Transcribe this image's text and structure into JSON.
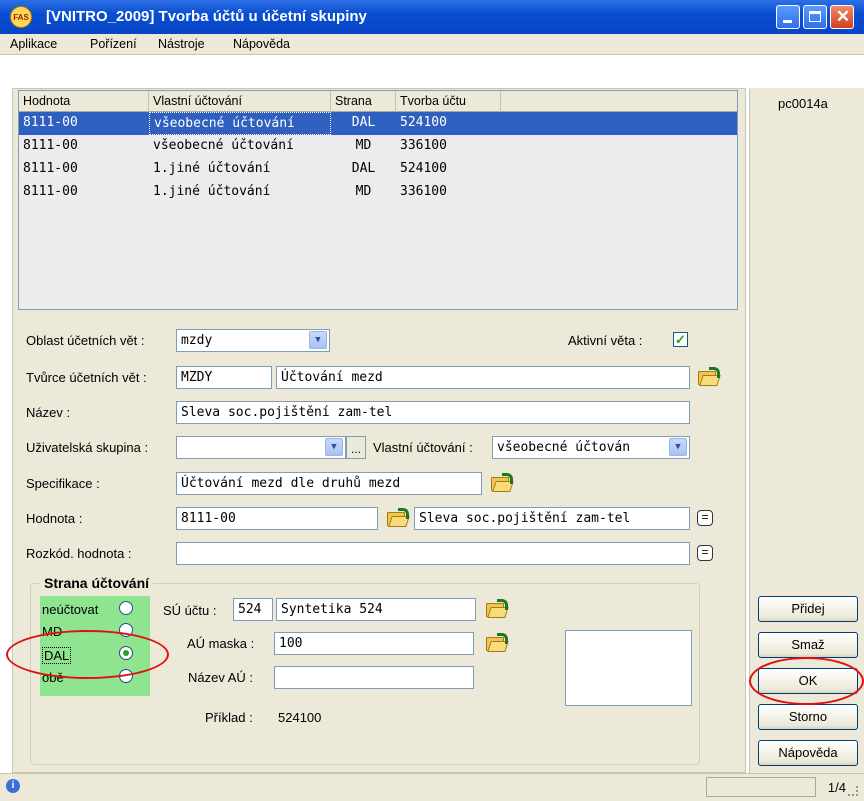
{
  "window": {
    "title": "[VNITRO_2009] Tvorba účtů u účetní skupiny",
    "logo_text": "FAS",
    "form_code": "pc0014a"
  },
  "menu": [
    "Aplikace",
    "Pořízení",
    "Nástroje",
    "Nápověda"
  ],
  "table": {
    "columns": [
      "Hodnota",
      "Vlastní účtování",
      "Strana",
      "Tvorba účtu"
    ],
    "rows": [
      [
        "8111-00",
        "všeobecné účtování",
        "DAL",
        "524100"
      ],
      [
        "8111-00",
        "všeobecné účtování",
        "MD",
        "336100"
      ],
      [
        "8111-00",
        "1.jiné účtování",
        "DAL",
        "524100"
      ],
      [
        "8111-00",
        "1.jiné účtování",
        "MD",
        "336100"
      ]
    ],
    "selected_row": 0
  },
  "form": {
    "oblast": {
      "label": "Oblast účetních vět :",
      "value": "mzdy"
    },
    "aktivni": {
      "label": "Aktivní věta :",
      "checked": true
    },
    "tvurce": {
      "label": "Tvůrce účetních vět :",
      "code": "MZDY",
      "name": "Účtování mezd"
    },
    "nazev": {
      "label": "Název :",
      "value": "Sleva soc.pojištění zam-tel"
    },
    "uzivatelska": {
      "label": "Uživatelská skupina :",
      "value": ""
    },
    "vlastni": {
      "label": "Vlastní účtování :",
      "value": "všeobecné účtován"
    },
    "specifikace": {
      "label": "Specifikace :",
      "value": "Účtování mezd dle druhů mezd"
    },
    "hodnota": {
      "label": "Hodnota :",
      "value": "8111-00",
      "name": "Sleva soc.pojištění zam-tel"
    },
    "rozkod": {
      "label": "Rozkód. hodnota :",
      "value": ""
    }
  },
  "strana": {
    "title": "Strana účtování",
    "options": [
      "neúčtovat",
      "MD",
      "DAL",
      "obě"
    ],
    "selected": "DAL",
    "su_label": "SÚ účtu :",
    "su_code": "524",
    "su_name": "Syntetika 524",
    "au_label": "AÚ maska :",
    "au_value": "100",
    "nazev_au_label": "Název AÚ :",
    "nazev_au_value": "",
    "priklad_label": "Příklad :",
    "priklad_value": "524100"
  },
  "buttons": {
    "pridej": "Přidej",
    "smaz": "Smaž",
    "ok": "OK",
    "storno": "Storno",
    "napoveda": "Nápověda"
  },
  "status": {
    "page": "1/4"
  },
  "colors": {
    "title_bar": "#0a4fd0",
    "selection": "#2f5fbf",
    "green_highlight": "#8fe58f",
    "annotation_red": "#e01010"
  }
}
